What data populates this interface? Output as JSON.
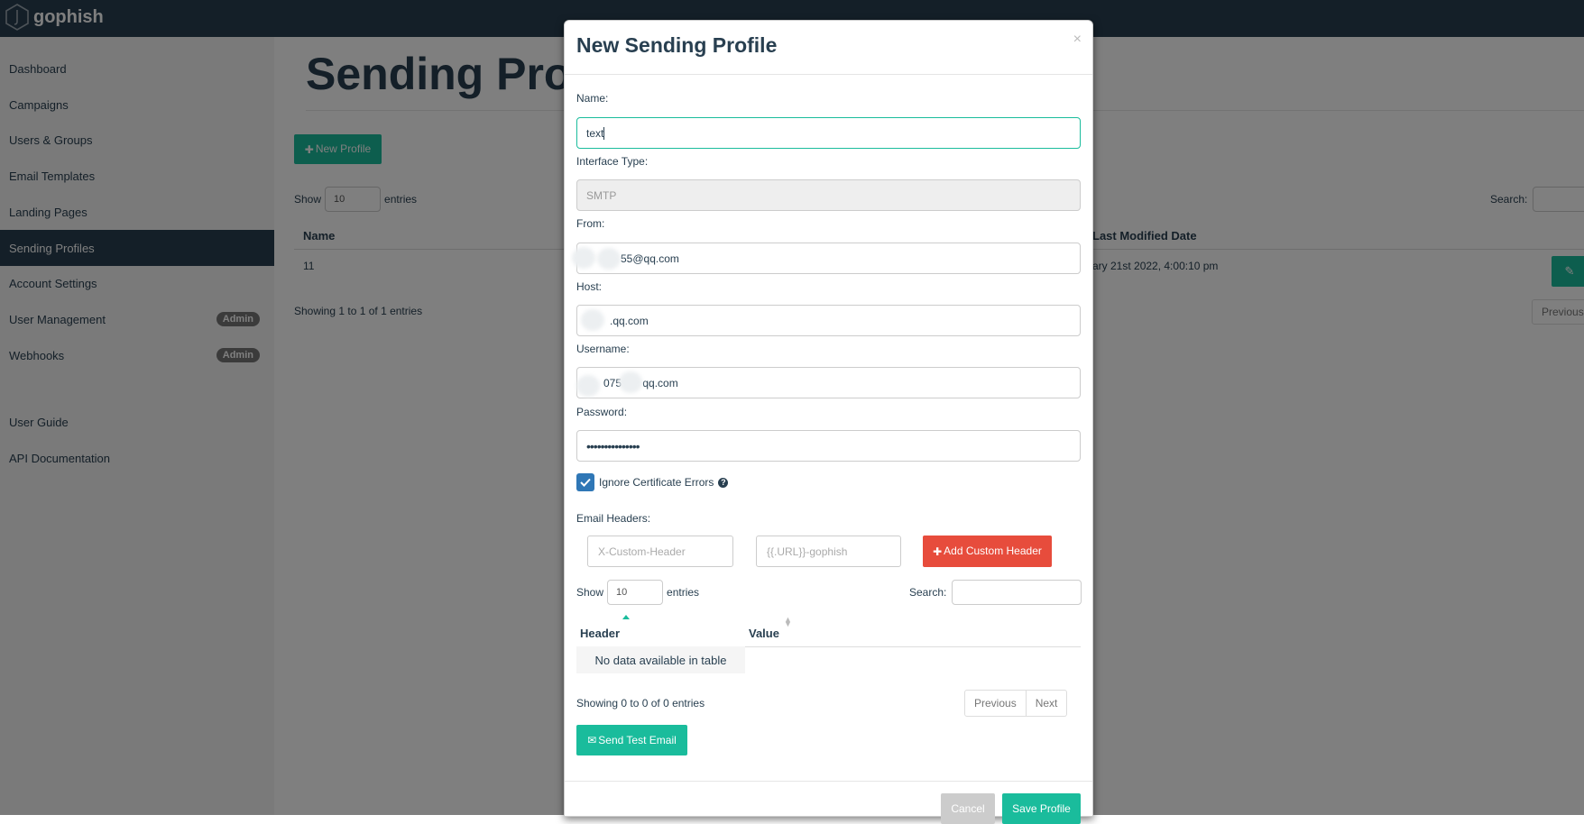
{
  "app": {
    "brand": "gophish"
  },
  "sidebar": {
    "items": [
      {
        "label": "Dashboard"
      },
      {
        "label": "Campaigns"
      },
      {
        "label": "Users & Groups"
      },
      {
        "label": "Email Templates"
      },
      {
        "label": "Landing Pages"
      },
      {
        "label": "Sending Profiles"
      },
      {
        "label": "Account Settings"
      },
      {
        "label": "User Management",
        "badge": "Admin"
      },
      {
        "label": "Webhooks",
        "badge": "Admin"
      },
      {
        "label": "User Guide"
      },
      {
        "label": "API Documentation"
      }
    ],
    "active": "Sending Profiles"
  },
  "page": {
    "title": "Sending Profiles",
    "new_button": "New Profile",
    "show_label": "Show",
    "entries_label": "entries",
    "entries_value": "10",
    "search_label": "Search:",
    "columns": [
      "Name",
      "Last Modified Date"
    ],
    "rows": [
      {
        "name": "11",
        "modified": "ary 21st 2022, 4:00:10 pm"
      }
    ],
    "info": "Showing 1 to 1 of 1 entries",
    "previous": "Previous"
  },
  "modal": {
    "title": "New Sending Profile",
    "close": "×",
    "name_label": "Name:",
    "name_value": "text",
    "interface_label": "Interface Type:",
    "interface_value": "SMTP",
    "from_label": "From:",
    "from_value": "55@qq.com",
    "host_label": "Host:",
    "host_value": ".qq.com",
    "username_label": "Username:",
    "username_value": "075       qq.com",
    "password_label": "Password:",
    "password_value": "•••••••••••••••",
    "ignore_cert_label": "Ignore Certificate Errors",
    "email_headers_label": "Email Headers:",
    "header_placeholder": "X-Custom-Header",
    "value_placeholder": "{{.URL}}-gophish",
    "add_header_button": "Add Custom Header",
    "show_label": "Show",
    "entries_value": "10",
    "entries_label": "entries",
    "search_label": "Search:",
    "table_columns": [
      "Header",
      "Value"
    ],
    "empty_text": "No data available in table",
    "info": "Showing 0 to 0 of 0 entries",
    "previous": "Previous",
    "next": "Next",
    "send_test_button": "Send Test Email",
    "cancel_button": "Cancel",
    "save_button": "Save Profile"
  },
  "colors": {
    "navy": "#283f50",
    "green": "#1abc9c",
    "red": "#e74c3c",
    "checkbox": "#2f77b6"
  }
}
